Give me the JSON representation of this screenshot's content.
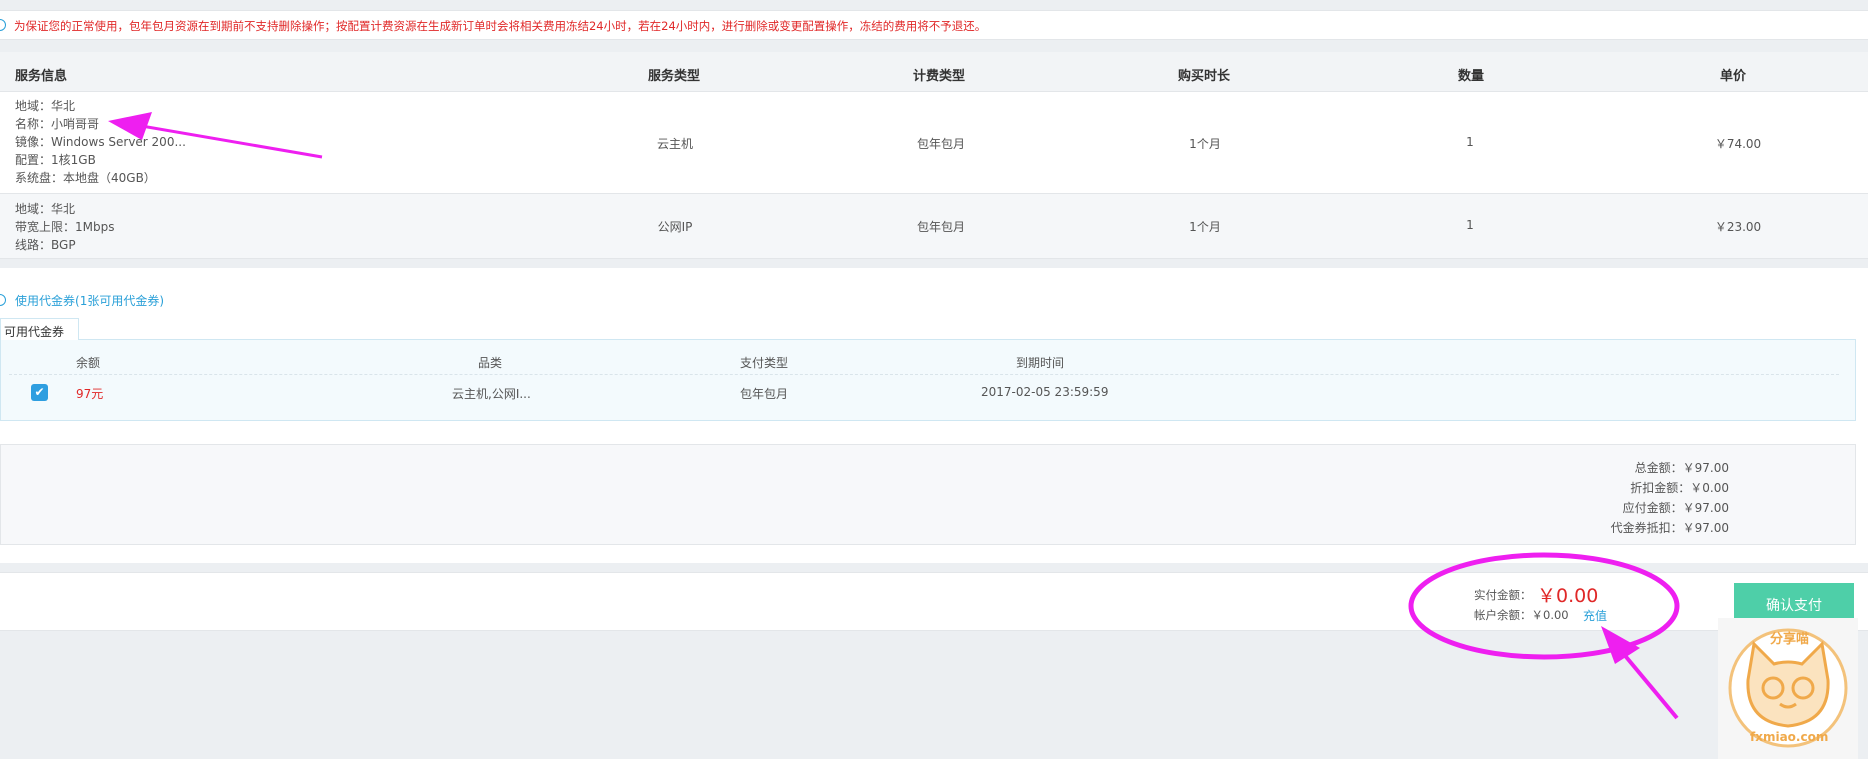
{
  "notice": {
    "icon": "info-circle-icon",
    "text": "为保证您的正常使用，包年包月资源在到期前不支持删除操作；按配置计费资源在生成新订单时会将相关费用冻结24小时，若在24小时内，进行删除或变更配置操作，冻结的费用将不予退还。"
  },
  "order": {
    "headers": [
      "服务信息",
      "服务类型",
      "计费类型",
      "购买时长",
      "数量",
      "单价"
    ],
    "rows": [
      {
        "info": [
          "地域：华北",
          "名称：小哨哥哥",
          "镜像：Windows Server 200...",
          "配置：1核1GB",
          "系统盘：本地盘（40GB）"
        ],
        "service_type": "云主机",
        "billing_type": "包年包月",
        "duration": "1个月",
        "quantity": "1",
        "unit_price": "￥74.00"
      },
      {
        "info": [
          "地域：华北",
          "带宽上限：1Mbps",
          "线路：BGP"
        ],
        "service_type": "公网IP",
        "billing_type": "包年包月",
        "duration": "1个月",
        "quantity": "1",
        "unit_price": "￥23.00"
      }
    ]
  },
  "coupon": {
    "toggle_prefix": "使用代金券(",
    "toggle_count": "1张可用代金券",
    "toggle_suffix": ")",
    "tab_label": "可用代金券",
    "headers": [
      "余额",
      "品类",
      "支付类型",
      "到期时间"
    ],
    "row": {
      "checked": true,
      "balance": "97元",
      "category": "云主机,公网I...",
      "pay_type": "包年包月",
      "expire": "2017-02-05 23:59:59"
    }
  },
  "summary": {
    "total": "总金额：￥97.00",
    "discount": "折扣金额：￥0.00",
    "payable": "应付金额：￥97.00",
    "coupon_deduct": "代金券抵扣：￥97.00"
  },
  "pay": {
    "actual_label": "实付金额：",
    "actual_amount": "￥0.00",
    "balance_label": "帐户余额：￥0.00",
    "recharge_label": "充值",
    "confirm_label": "确认支付"
  },
  "watermark": {
    "top_text": "分享喵",
    "bottom_text": "fxmiao.com"
  },
  "colors": {
    "accent_blue": "#2aa0d8",
    "warning_red": "#e02828",
    "confirm_green": "#4ecfa8",
    "annotation_magenta": "#ee1ff0"
  }
}
